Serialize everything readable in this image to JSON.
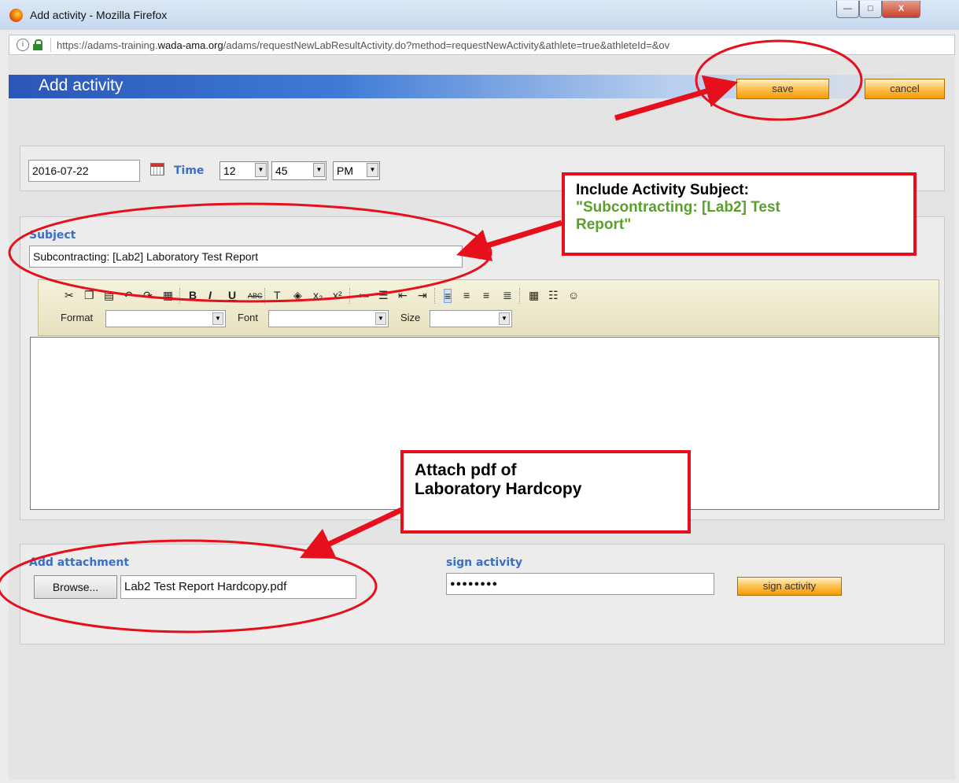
{
  "window": {
    "title": "Add activity - Mozilla Firefox",
    "controls": {
      "minimize": "—",
      "maximize": "□",
      "close": "X"
    }
  },
  "urlbar": {
    "info_icon": "i",
    "url_prefix": "https://adams-training.",
    "url_domain": "wada-ama.org",
    "url_path": "/adams/requestNewLabResultActivity.do?method=requestNewActivity&athlete=true&athleteId=&ov"
  },
  "header": {
    "title": "Add activity",
    "save_label": "save",
    "cancel_label": "cancel"
  },
  "datetime": {
    "date_value": "2016-07-22",
    "time_label": "Time",
    "hour": "12",
    "minute": "45",
    "ampm": "PM"
  },
  "subject": {
    "label": "Subject",
    "value": "Subcontracting: [Lab2] Laboratory Test Report"
  },
  "editor": {
    "toolbar_icons": [
      "cut-icon",
      "copy-icon",
      "paste-icon",
      "undo-icon",
      "redo-icon",
      "select-all-icon",
      "bold-icon",
      "italic-icon",
      "underline-icon",
      "strikethrough-icon",
      "text-color-icon",
      "background-color-icon",
      "subscript-icon",
      "superscript-icon",
      "numbered-list-icon",
      "bulleted-list-icon",
      "outdent-icon",
      "indent-icon",
      "align-left-icon",
      "align-center-icon",
      "align-right-icon",
      "justify-icon",
      "table-icon",
      "horizontal-rule-icon",
      "smiley-icon"
    ],
    "format_label": "Format",
    "font_label": "Font",
    "size_label": "Size",
    "bold_glyph": "B",
    "italic_glyph": "I",
    "underline_glyph": "U",
    "strike_glyph": "ABC"
  },
  "attachment": {
    "label": "Add attachment",
    "browse_label": "Browse...",
    "file_name": "Lab2 Test Report Hardcopy.pdf"
  },
  "sign": {
    "label": "sign activity",
    "password_mask": "●●●●●●●●",
    "button_label": "sign activity"
  },
  "annotations": {
    "callout_subject_line1": "Include Activity Subject:",
    "callout_subject_line2": "\"Subcontracting: [Lab2] Test",
    "callout_subject_line3": "Report\"",
    "callout_attach_line1": "Attach pdf of",
    "callout_attach_line2": "Laboratory Hardcopy",
    "highlight_color": "#e5101c",
    "subject_text_color": "#5aa02c"
  }
}
